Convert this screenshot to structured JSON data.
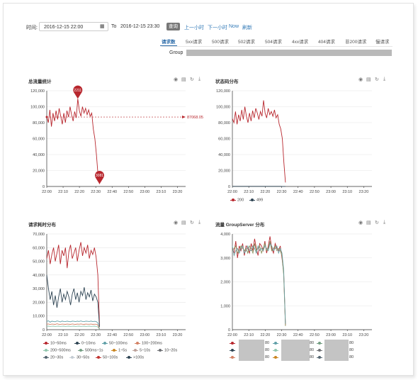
{
  "filter": {
    "time_label": "时间:",
    "start_value": "2016-12-15 22:00",
    "to_label": "To",
    "end_value": "2016-12-15 23:30",
    "query_label": "查询",
    "prev_hour": "上一小时",
    "next_hour": "下一小时",
    "now": "Now",
    "refresh": "刷新"
  },
  "tabs": [
    "请求数",
    "5xx请求",
    "500请求",
    "502请求",
    "504请求",
    "4xx请求",
    "404请求",
    "非200请求",
    "慢请求"
  ],
  "group_label": "Group",
  "panels": {
    "total": {
      "title": "总流量统计",
      "peak_label": "2211",
      "low_label": "3081",
      "mark_line_label": "87068.05"
    },
    "status": {
      "title": "状态码分布",
      "legend": [
        "200",
        "499"
      ]
    },
    "latency": {
      "title": "请求耗时分布",
      "legend": [
        "10~50ms",
        "0~10ms",
        "50~100ms",
        "100~200ms",
        "200~500ms",
        "500ms~1s",
        "1~5s",
        "5~10s",
        "10~20s",
        "20~30s",
        "30~50s",
        "50~100s",
        ">100s"
      ]
    },
    "group": {
      "title": "流量 GroupServer 分布",
      "legend_values": [
        "80",
        "80",
        "80",
        "80",
        "80",
        "80",
        "80",
        "80",
        "80"
      ]
    }
  },
  "colors": {
    "red": "#b8272e",
    "navy": "#2f4554",
    "accent": "#2a6aa8"
  },
  "chart_data": [
    {
      "type": "line",
      "title": "总流量统计",
      "x": [
        "22:00",
        "22:10",
        "22:20",
        "22:30",
        "22:40",
        "22:50",
        "23:00",
        "23:10",
        "23:20"
      ],
      "ylim": [
        0,
        120000
      ],
      "yticks": [
        0,
        20000,
        40000,
        60000,
        80000,
        100000,
        120000
      ],
      "series": [
        {
          "values": [
            88000,
            80000,
            96000,
            75000,
            92000,
            82000,
            95000,
            84000,
            98000,
            88000,
            78000,
            92000,
            80000,
            95000,
            87000,
            100000,
            90000,
            82000,
            94000,
            86000,
            110000,
            95000,
            88000,
            100000,
            92000,
            98000,
            90000,
            96000,
            88000,
            92000,
            72000,
            60000,
            40000,
            15000,
            3000
          ]
        }
      ],
      "mark_point_max": 110000,
      "mark_point_min": 3000,
      "mark_line": 87068.05
    },
    {
      "type": "line",
      "title": "状态码分布",
      "x": [
        "22:00",
        "22:10",
        "22:20",
        "22:30",
        "22:40",
        "22:50",
        "23:00",
        "23:10",
        "23:20"
      ],
      "ylim": [
        0,
        120000
      ],
      "yticks": [
        0,
        20000,
        40000,
        60000,
        80000,
        100000,
        120000
      ],
      "series": [
        {
          "name": "200",
          "values": [
            85000,
            80000,
            94000,
            78000,
            90000,
            82000,
            96000,
            84000,
            100000,
            88000,
            80000,
            92000,
            82000,
            95000,
            86000,
            98000,
            92000,
            84000,
            94000,
            88000,
            108000,
            92000,
            86000,
            98000,
            90000,
            94000,
            88000,
            96000,
            86000,
            90000,
            78000,
            72000,
            60000,
            30000,
            5000
          ]
        },
        {
          "name": "499",
          "values": [
            200,
            200,
            200,
            200,
            200,
            200,
            200,
            200,
            200,
            200,
            200,
            200,
            200,
            200,
            200,
            200,
            200,
            200,
            200,
            200,
            200,
            200,
            200,
            200,
            200,
            200,
            200,
            200,
            200,
            200,
            200,
            200,
            100,
            50,
            0
          ]
        }
      ]
    },
    {
      "type": "line",
      "title": "请求耗时分布",
      "x": [
        "22:00",
        "22:10",
        "22:20",
        "22:30",
        "22:40",
        "22:50",
        "23:00",
        "23:10",
        "23:20"
      ],
      "ylim": [
        0,
        70000
      ],
      "yticks": [
        0,
        10000,
        20000,
        30000,
        40000,
        50000,
        60000,
        70000
      ],
      "series": [
        {
          "name": "10~50ms",
          "values": [
            52000,
            58000,
            48000,
            55000,
            60000,
            50000,
            56000,
            62000,
            48000,
            58000,
            54000,
            60000,
            45000,
            57000,
            62000,
            52000,
            56000,
            60000,
            50000,
            58000,
            64000,
            54000,
            60000,
            56000,
            62000,
            52000,
            58000,
            55000,
            60000,
            53000,
            40000,
            3000
          ]
        },
        {
          "name": "0~10ms",
          "values": [
            40000,
            30000,
            22000,
            28000,
            18000,
            25000,
            16000,
            24000,
            30000,
            20000,
            26000,
            22000,
            28000,
            24000,
            18000,
            26000,
            30000,
            22000,
            27000,
            20000,
            28000,
            25000,
            31000,
            22000,
            27000,
            24000,
            29000,
            21000,
            26000,
            24000,
            20000,
            2000
          ]
        },
        {
          "name": "50~100ms",
          "values": [
            6000,
            6500,
            5500,
            6200,
            6000,
            5800,
            6400,
            6100,
            5700,
            6300,
            6000,
            5900,
            6200,
            6000,
            5800,
            6300,
            6100,
            5900,
            6200,
            6000,
            6400,
            6000,
            5900,
            6200,
            6100,
            6000,
            6300,
            5900,
            6100,
            6000,
            5000,
            500
          ]
        },
        {
          "name": "100~200ms",
          "values": [
            4000,
            4200,
            3800,
            4100,
            4000,
            3900,
            4300,
            4000,
            3800,
            4100,
            4000,
            3900,
            4100,
            4000,
            3900,
            4200,
            4000,
            3900,
            4100,
            4000,
            4200,
            4000,
            3900,
            4100,
            4000,
            4000,
            4100,
            3900,
            4000,
            4000,
            3500,
            300
          ]
        },
        {
          "name": "200~500ms",
          "values": [
            2500,
            2600,
            2400,
            2500,
            2600,
            2400,
            2500,
            2600,
            2400,
            2500,
            2600,
            2400,
            2500,
            2600,
            2400,
            2500,
            2600,
            2400,
            2500,
            2600,
            2400,
            2500,
            2600,
            2400,
            2500,
            2600,
            2400,
            2500,
            2600,
            2400,
            2000,
            200
          ]
        }
      ]
    },
    {
      "type": "line",
      "title": "流量 GroupServer 分布",
      "x": [
        "22:00",
        "22:10",
        "22:20",
        "22:30",
        "22:40",
        "22:50",
        "23:00",
        "23:10",
        "23:20"
      ],
      "ylim": [
        0,
        4000
      ],
      "yticks": [
        0,
        1000,
        2000,
        3000,
        4000
      ],
      "series": [
        {
          "values": [
            3400,
            3200,
            3700,
            3000,
            3500,
            3300,
            3600,
            3100,
            3500,
            3400,
            3200,
            3600,
            3300,
            3800,
            3400,
            3100,
            3600,
            3500,
            3300,
            3700,
            3200,
            3500,
            3900,
            3400,
            3200,
            3600,
            3400,
            3300,
            3500,
            3000,
            2400,
            200
          ]
        },
        {
          "values": [
            3300,
            3400,
            3500,
            3200,
            3300,
            3500,
            3400,
            3300,
            3400,
            3200,
            3500,
            3400,
            3200,
            3600,
            3300,
            3400,
            3500,
            3200,
            3400,
            3600,
            3300,
            3400,
            3700,
            3300,
            3400,
            3500,
            3300,
            3400,
            3300,
            3100,
            2300,
            150
          ]
        },
        {
          "values": [
            3500,
            3100,
            3300,
            3400,
            3200,
            3400,
            3500,
            3200,
            3300,
            3500,
            3300,
            3300,
            3500,
            3400,
            3200,
            3500,
            3300,
            3400,
            3300,
            3500,
            3400,
            3300,
            3600,
            3500,
            3300,
            3400,
            3500,
            3200,
            3400,
            3200,
            2500,
            250
          ]
        }
      ]
    }
  ]
}
